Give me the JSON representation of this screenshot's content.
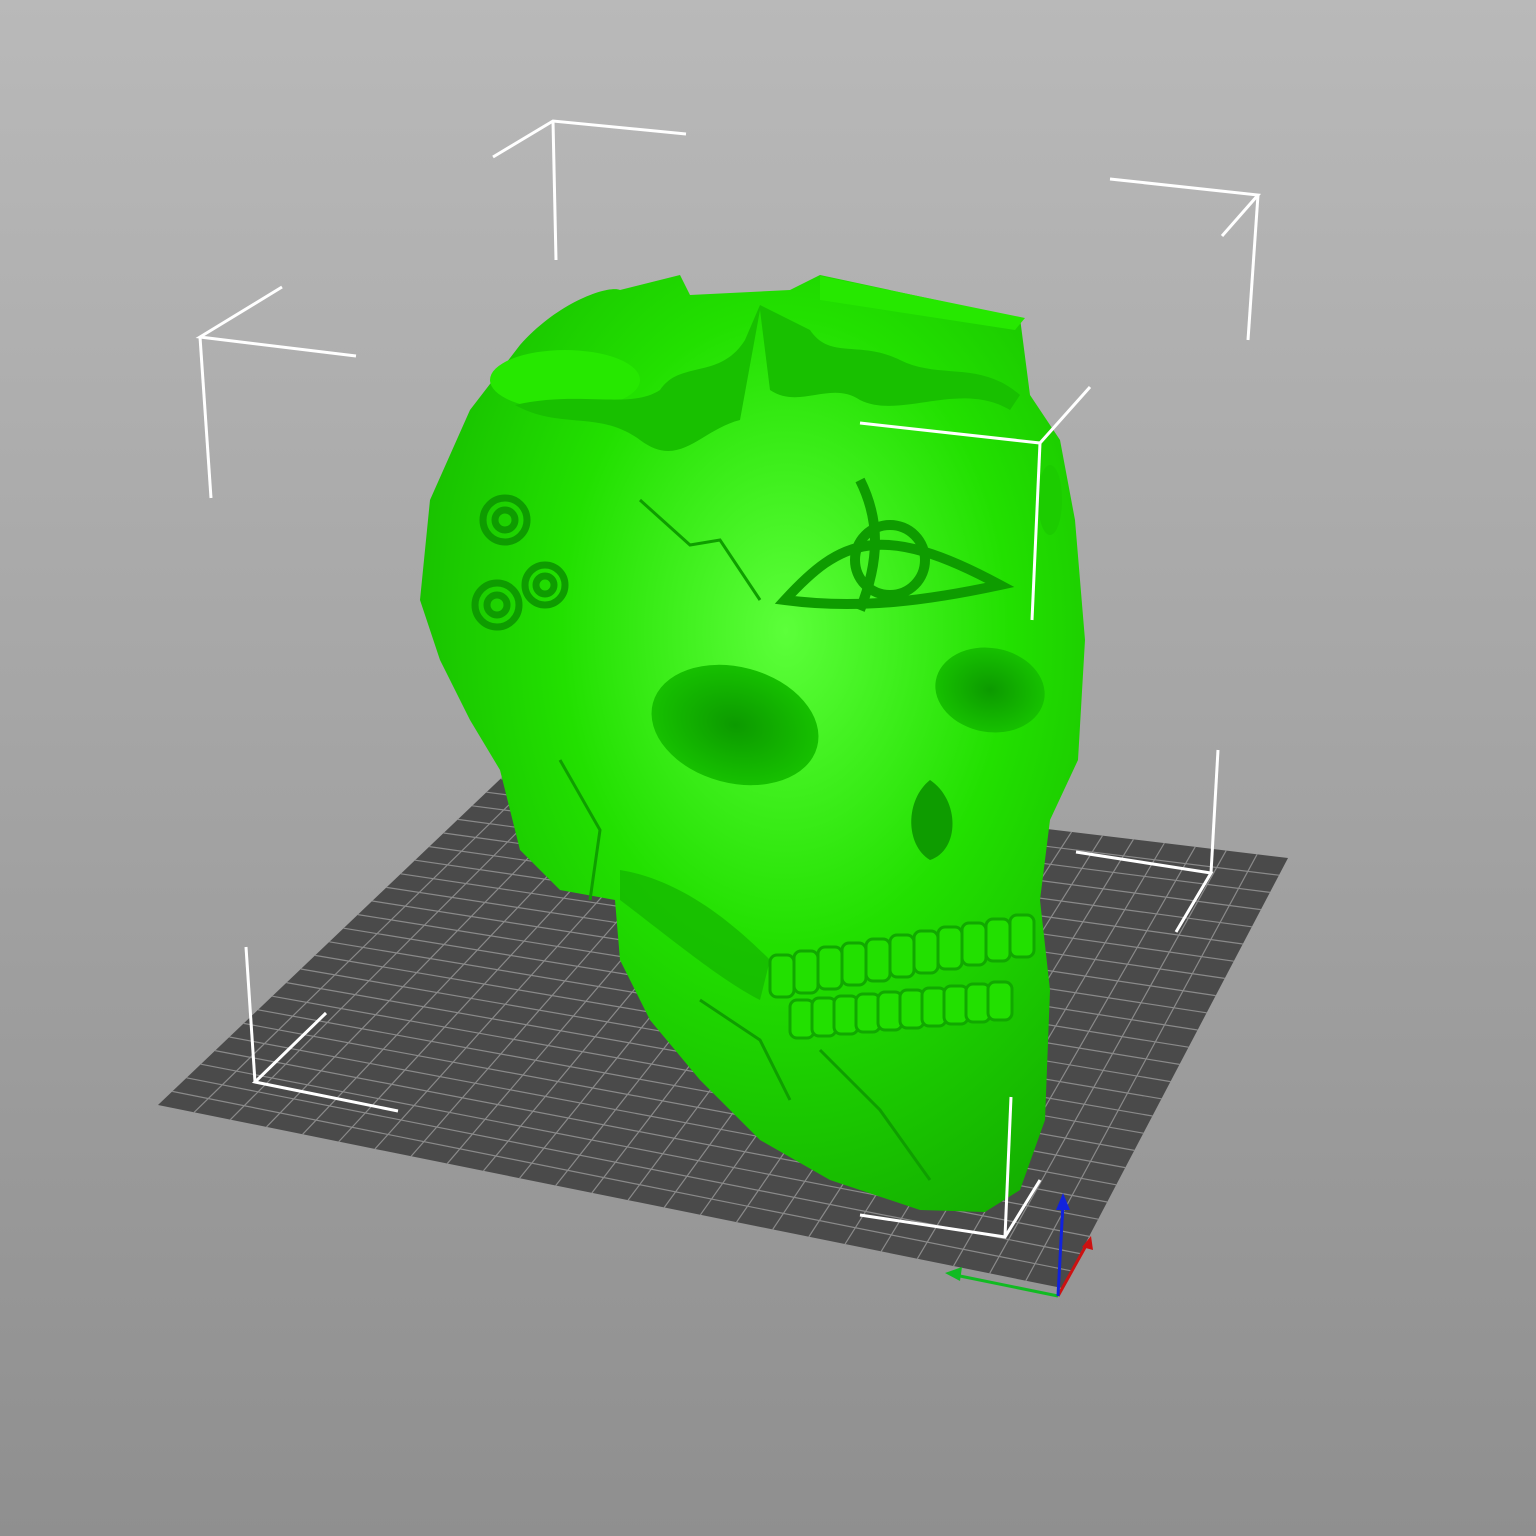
{
  "viewport": {
    "background_top": "#b9b9b9",
    "background_bottom": "#8f8f8f"
  },
  "bed": {
    "color": "#4a4a4a",
    "grid_line_color": "#8a8a8a",
    "grid_divisions": 25
  },
  "bounding_box": {
    "color": "#ffffff"
  },
  "model": {
    "name": "skull",
    "color": "#22e000",
    "shade_color": "#11a800",
    "highlight_color": "#5cff3a",
    "selected": true
  },
  "axes": {
    "x_color": "#cc1111",
    "y_color": "#11bb22",
    "z_color": "#1122dd"
  }
}
